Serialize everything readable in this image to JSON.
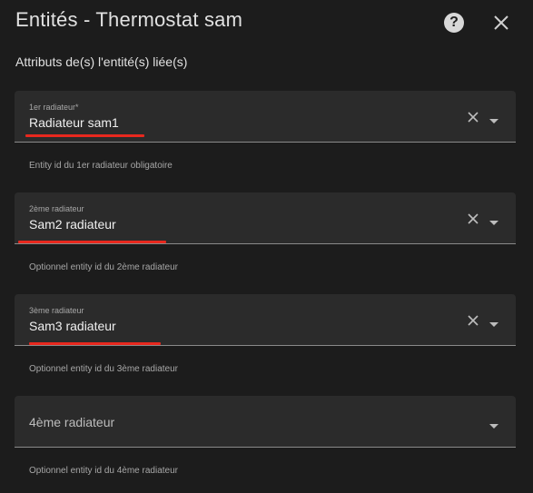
{
  "dialog": {
    "title": "Entités - Thermostat sam",
    "help_icon": "help-circle-icon",
    "close_icon": "close-icon",
    "subtitle": "Attributs de(s) l'entité(s) liée(s)"
  },
  "fields": [
    {
      "label": "1er radiateur*",
      "value": "Radiateur sam1",
      "helper": "Entity id du 1er radiateur obligatoire"
    },
    {
      "label": "2ème radiateur",
      "value": "Sam2 radiateur",
      "helper": "Optionnel entity id du 2ème radiateur"
    },
    {
      "label": "3ème radiateur",
      "value": "Sam3 radiateur",
      "helper": "Optionnel entity id du 3ème radiateur"
    },
    {
      "placeholder": "4ème radiateur",
      "helper": "Optionnel entity id du 4ème radiateur"
    }
  ],
  "colors": {
    "background": "#1c1c1c",
    "field_background": "#2b2b2b",
    "annotation_red": "#e8281e"
  }
}
